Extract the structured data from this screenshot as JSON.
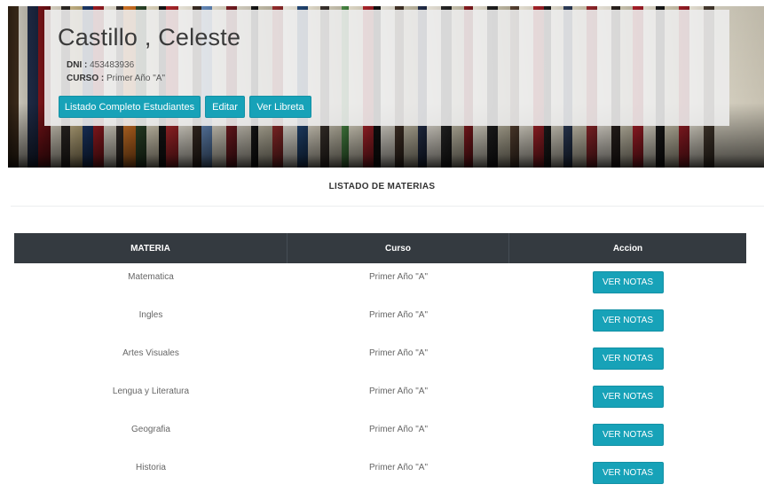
{
  "student": {
    "name": "Castillo , Celeste",
    "dni_label": "DNI :",
    "dni_value": "453483936",
    "curso_label": "CURSO :",
    "curso_value": "Primer Año \"A\""
  },
  "actions": {
    "listado_label": "Listado Completo Estudiantes",
    "editar_label": "Editar",
    "libreta_label": "Ver Libreta"
  },
  "section_title": "LISTADO DE MATERIAS",
  "table": {
    "headers": [
      "MATERIA",
      "Curso",
      "Accion"
    ],
    "rows": [
      {
        "materia": "Matematica",
        "curso": "Primer Año \"A\"",
        "accion": "VER NOTAS"
      },
      {
        "materia": "Ingles",
        "curso": "Primer Año \"A\"",
        "accion": "VER NOTAS"
      },
      {
        "materia": "Artes Visuales",
        "curso": "Primer Año \"A\"",
        "accion": "VER NOTAS"
      },
      {
        "materia": "Lengua y Literatura",
        "curso": "Primer Año \"A\"",
        "accion": "VER NOTAS"
      },
      {
        "materia": "Geografia",
        "curso": "Primer Año \"A\"",
        "accion": "VER NOTAS"
      },
      {
        "materia": "Historia",
        "curso": "Primer Año \"A\"",
        "accion": "VER NOTAS"
      }
    ]
  },
  "colors": {
    "accent": "#17a2b8",
    "table_header": "#343a40"
  }
}
